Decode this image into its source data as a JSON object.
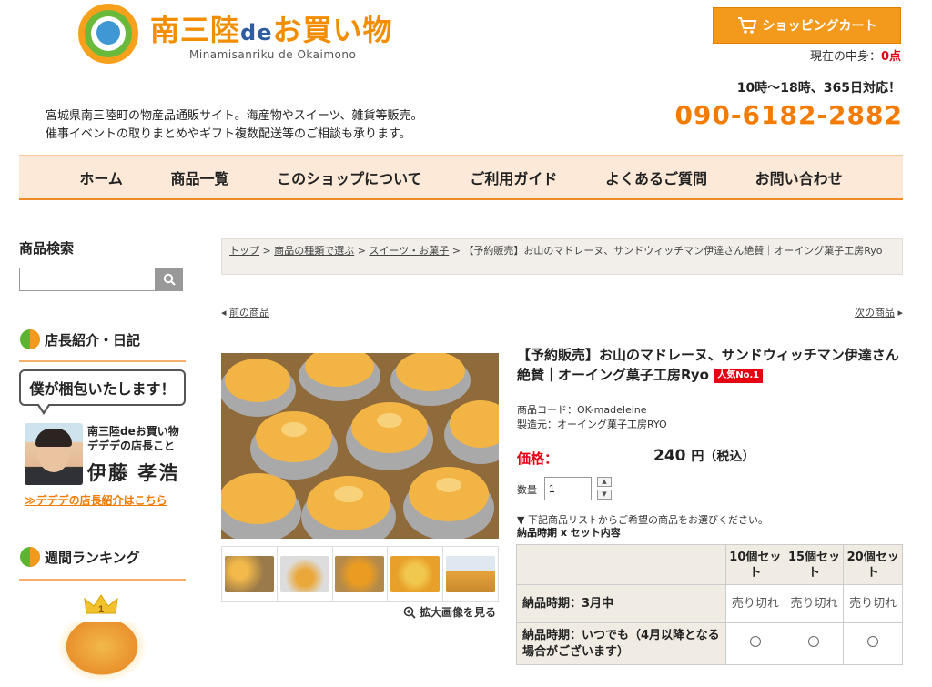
{
  "header": {
    "logo_main": "南三陸",
    "logo_de": "de",
    "logo_tail": "お買い物",
    "logo_sub": "Minamisanriku de Okaimono",
    "cart_label": "ショッピングカート",
    "cart_content_label": "現在の中身：",
    "cart_count": "0点",
    "hours": "10時〜18時、365日対応！",
    "phone": "090-6182-2882",
    "desc_line1": "宮城県南三陸町の物産品通販サイト。海産物やスイーツ、雑貨等販売。",
    "desc_line2": "催事イベントの取りまとめやギフト複数配送等のご相談も承ります。"
  },
  "nav": {
    "items": [
      "ホーム",
      "商品一覧",
      "このショップについて",
      "ご利用ガイド",
      "よくあるご質問",
      "お問い合わせ"
    ]
  },
  "sidebar": {
    "search_title": "商品検索",
    "search_value": "",
    "staff_title": "店長紹介・日記",
    "bubble": "僕が梱包いたします！",
    "staff_line1": "南三陸deお買い物",
    "staff_line2": "デデデの店長こと",
    "staff_name": "伊藤 孝浩",
    "staff_link": "≫デデデの店長紹介はこちら",
    "ranking_title": "週間ランキング"
  },
  "breadcrumb": {
    "top": "トップ",
    "sep": ">",
    "category_type": "商品の種類で選ぶ",
    "category": "スイーツ・お菓子",
    "current": "【予約販売】お山のマドレーヌ、サンドウィッチマン伊達さん絶賛｜オーイング菓子工房Ryo"
  },
  "pager": {
    "prev": "前の商品",
    "next": "次の商品"
  },
  "product": {
    "title": "【予約販売】お山のマドレーヌ、サンドウィッチマン伊達さん絶賛｜オーイング菓子工房Ryo",
    "badge": "人気No.1",
    "code": "商品コード：OK-madeleine",
    "maker": "製造元：オーイング菓子工房RYO",
    "price_label": "価格：",
    "price_value": "240",
    "price_unit": "円（税込）",
    "qty_label": "数量",
    "qty_value": "1",
    "zoom": "拡大画像を見る",
    "note1": "▼ 下記商品リストからご希望の商品をお選びください。",
    "note2": "納品時期 x セット内容"
  },
  "options": {
    "columns": [
      "10個セット",
      "15個セット",
      "20個セット"
    ],
    "rows": [
      {
        "label": "納品時期：3月中",
        "cells": [
          "売り切れ",
          "売り切れ",
          "売り切れ"
        ]
      },
      {
        "label": "納品時期：いつでも（4月以降となる場合がございます）",
        "cells": [
          "○",
          "○",
          "○"
        ]
      }
    ]
  },
  "colors": {
    "accent": "#f27b00",
    "nav_bg": "#fde9d8",
    "price_red": "#e60012"
  }
}
